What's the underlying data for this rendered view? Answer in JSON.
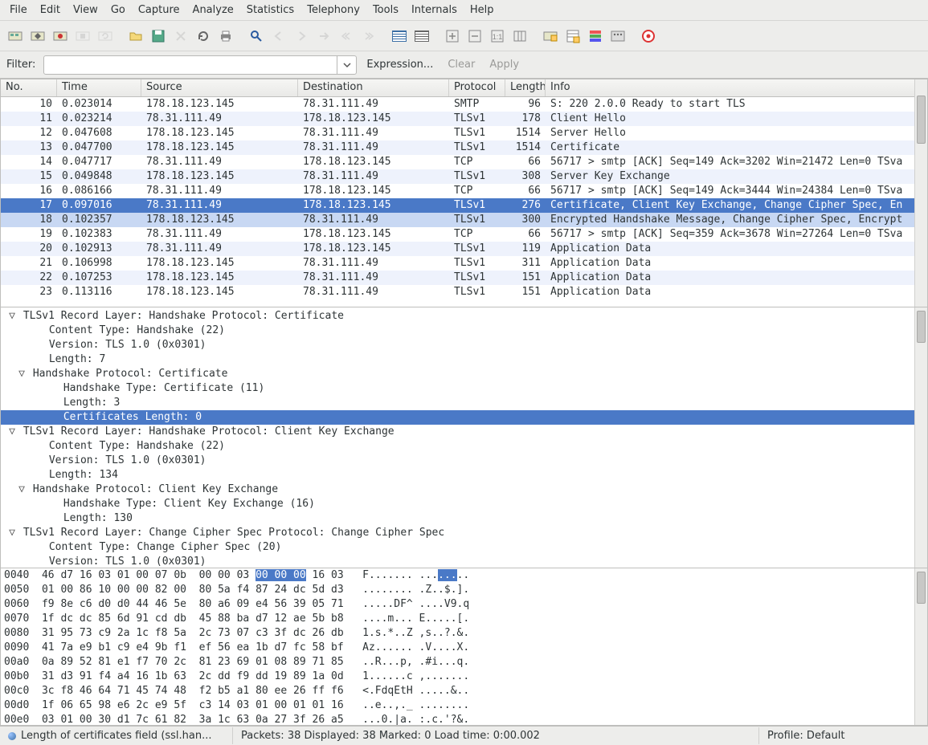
{
  "menu": [
    "File",
    "Edit",
    "View",
    "Go",
    "Capture",
    "Analyze",
    "Statistics",
    "Telephony",
    "Tools",
    "Internals",
    "Help"
  ],
  "filter": {
    "label": "Filter:",
    "value": "",
    "expression": "Expression...",
    "clear": "Clear",
    "apply": "Apply"
  },
  "columns": {
    "no": "No.",
    "time": "Time",
    "source": "Source",
    "destination": "Destination",
    "protocol": "Protocol",
    "length": "Length",
    "info": "Info"
  },
  "packets": [
    {
      "no": 10,
      "time": "0.023014",
      "src": "178.18.123.145",
      "dst": "78.31.111.49",
      "proto": "SMTP",
      "len": 96,
      "info": "S: 220 2.0.0 Ready to start TLS",
      "cls": "even"
    },
    {
      "no": 11,
      "time": "0.023214",
      "src": "78.31.111.49",
      "dst": "178.18.123.145",
      "proto": "TLSv1",
      "len": 178,
      "info": "Client Hello",
      "cls": "odd"
    },
    {
      "no": 12,
      "time": "0.047608",
      "src": "178.18.123.145",
      "dst": "78.31.111.49",
      "proto": "TLSv1",
      "len": 1514,
      "info": "Server Hello",
      "cls": "even"
    },
    {
      "no": 13,
      "time": "0.047700",
      "src": "178.18.123.145",
      "dst": "78.31.111.49",
      "proto": "TLSv1",
      "len": 1514,
      "info": "Certificate",
      "cls": "odd"
    },
    {
      "no": 14,
      "time": "0.047717",
      "src": "78.31.111.49",
      "dst": "178.18.123.145",
      "proto": "TCP",
      "len": 66,
      "info": "56717 > smtp [ACK] Seq=149 Ack=3202 Win=21472 Len=0 TSva",
      "cls": "even"
    },
    {
      "no": 15,
      "time": "0.049848",
      "src": "178.18.123.145",
      "dst": "78.31.111.49",
      "proto": "TLSv1",
      "len": 308,
      "info": "Server Key Exchange",
      "cls": "odd"
    },
    {
      "no": 16,
      "time": "0.086166",
      "src": "78.31.111.49",
      "dst": "178.18.123.145",
      "proto": "TCP",
      "len": 66,
      "info": "56717 > smtp [ACK] Seq=149 Ack=3444 Win=24384 Len=0 TSva",
      "cls": "even"
    },
    {
      "no": 17,
      "time": "0.097016",
      "src": "78.31.111.49",
      "dst": "178.18.123.145",
      "proto": "TLSv1",
      "len": 276,
      "info": "Certificate, Client Key Exchange, Change Cipher Spec, En",
      "cls": "selected"
    },
    {
      "no": 18,
      "time": "0.102357",
      "src": "178.18.123.145",
      "dst": "78.31.111.49",
      "proto": "TLSv1",
      "len": 300,
      "info": "Encrypted Handshake Message, Change Cipher Spec, Encrypt",
      "cls": "related"
    },
    {
      "no": 19,
      "time": "0.102383",
      "src": "78.31.111.49",
      "dst": "178.18.123.145",
      "proto": "TCP",
      "len": 66,
      "info": "56717 > smtp [ACK] Seq=359 Ack=3678 Win=27264 Len=0 TSva",
      "cls": "even"
    },
    {
      "no": 20,
      "time": "0.102913",
      "src": "78.31.111.49",
      "dst": "178.18.123.145",
      "proto": "TLSv1",
      "len": 119,
      "info": "Application Data",
      "cls": "odd"
    },
    {
      "no": 21,
      "time": "0.106998",
      "src": "178.18.123.145",
      "dst": "78.31.111.49",
      "proto": "TLSv1",
      "len": 311,
      "info": "Application Data",
      "cls": "even"
    },
    {
      "no": 22,
      "time": "0.107253",
      "src": "178.18.123.145",
      "dst": "78.31.111.49",
      "proto": "TLSv1",
      "len": 151,
      "info": "Application Data",
      "cls": "odd"
    },
    {
      "no": 23,
      "time": "0.113116",
      "src": "178.18.123.145",
      "dst": "78.31.111.49",
      "proto": "TLSv1",
      "len": 151,
      "info": "Application Data",
      "cls": "even"
    }
  ],
  "tree": [
    {
      "ind": "ind0b",
      "exp": "▽",
      "sel": false,
      "text": "TLSv1 Record Layer: Handshake Protocol: Certificate"
    },
    {
      "ind": "ind1",
      "exp": "",
      "sel": false,
      "text": "Content Type: Handshake (22)"
    },
    {
      "ind": "ind1",
      "exp": "",
      "sel": false,
      "text": "Version: TLS 1.0 (0x0301)"
    },
    {
      "ind": "ind1",
      "exp": "",
      "sel": false,
      "text": "Length: 7"
    },
    {
      "ind": "ind0",
      "exp": "▽",
      "sel": false,
      "text": "Handshake Protocol: Certificate"
    },
    {
      "ind": "ind2",
      "exp": "",
      "sel": false,
      "text": "Handshake Type: Certificate (11)"
    },
    {
      "ind": "ind2",
      "exp": "",
      "sel": false,
      "text": "Length: 3"
    },
    {
      "ind": "ind2",
      "exp": "",
      "sel": true,
      "text": "Certificates Length: 0"
    },
    {
      "ind": "ind0b",
      "exp": "▽",
      "sel": false,
      "text": "TLSv1 Record Layer: Handshake Protocol: Client Key Exchange"
    },
    {
      "ind": "ind1",
      "exp": "",
      "sel": false,
      "text": "Content Type: Handshake (22)"
    },
    {
      "ind": "ind1",
      "exp": "",
      "sel": false,
      "text": "Version: TLS 1.0 (0x0301)"
    },
    {
      "ind": "ind1",
      "exp": "",
      "sel": false,
      "text": "Length: 134"
    },
    {
      "ind": "ind0",
      "exp": "▽",
      "sel": false,
      "text": "Handshake Protocol: Client Key Exchange"
    },
    {
      "ind": "ind2",
      "exp": "",
      "sel": false,
      "text": "Handshake Type: Client Key Exchange (16)"
    },
    {
      "ind": "ind2",
      "exp": "",
      "sel": false,
      "text": "Length: 130"
    },
    {
      "ind": "ind0b",
      "exp": "▽",
      "sel": false,
      "text": "TLSv1 Record Layer: Change Cipher Spec Protocol: Change Cipher Spec"
    },
    {
      "ind": "ind1",
      "exp": "",
      "sel": false,
      "text": "Content Type: Change Cipher Spec (20)"
    },
    {
      "ind": "ind1",
      "exp": "",
      "sel": false,
      "text": "Version: TLS 1.0 (0x0301)"
    }
  ],
  "hex": [
    {
      "off": "0040",
      "h1": "46 d7 16 03 01 00 07 0b",
      "h2pre": "00 00 03 ",
      "h2hl": "00 00 00",
      "h2post": " 16 03",
      "a1": "F....... ...",
      "a2hl": "...",
      "a2post": ".."
    },
    {
      "off": "0050",
      "h1": "01 00 86 10 00 00 82 00",
      "h2": "80 5a f4 87 24 dc 5d d3",
      "a": "........ .Z..$.]."
    },
    {
      "off": "0060",
      "h1": "f9 8e c6 d0 d0 44 46 5e",
      "h2": "80 a6 09 e4 56 39 05 71",
      "a": ".....DF^ ....V9.q"
    },
    {
      "off": "0070",
      "h1": "1f dc dc 85 6d 91 cd db",
      "h2": "45 88 ba d7 12 ae 5b b8",
      "a": "....m... E.....[."
    },
    {
      "off": "0080",
      "h1": "31 95 73 c9 2a 1c f8 5a",
      "h2": "2c 73 07 c3 3f dc 26 db",
      "a": "1.s.*..Z ,s..?.&."
    },
    {
      "off": "0090",
      "h1": "41 7a e9 b1 c9 e4 9b f1",
      "h2": "ef 56 ea 1b d7 fc 58 bf",
      "a": "Az...... .V....X."
    },
    {
      "off": "00a0",
      "h1": "0a 89 52 81 e1 f7 70 2c",
      "h2": "81 23 69 01 08 89 71 85",
      "a": "..R...p, .#i...q."
    },
    {
      "off": "00b0",
      "h1": "31 d3 91 f4 a4 16 1b 63",
      "h2": "2c dd f9 dd 19 89 1a 0d",
      "a": "1......c ,......."
    },
    {
      "off": "00c0",
      "h1": "3c f8 46 64 71 45 74 48",
      "h2": "f2 b5 a1 80 ee 26 ff f6",
      "a": "<.FdqEtH .....&.."
    },
    {
      "off": "00d0",
      "h1": "1f 06 65 98 e6 2c e9 5f",
      "h2": "c3 14 03 01 00 01 01 16",
      "a": "..e..,._ ........"
    },
    {
      "off": "00e0",
      "h1": "03 01 00 30 d1 7c 61 82",
      "h2": "3a 1c 63 0a 27 3f 26 a5",
      "a": "...0.|a. :.c.'?&."
    }
  ],
  "status": {
    "field": "Length of certificates field (ssl.han...",
    "packets": "Packets: 38 Displayed: 38 Marked: 0 Load time: 0:00.002",
    "profile": "Profile: Default"
  }
}
